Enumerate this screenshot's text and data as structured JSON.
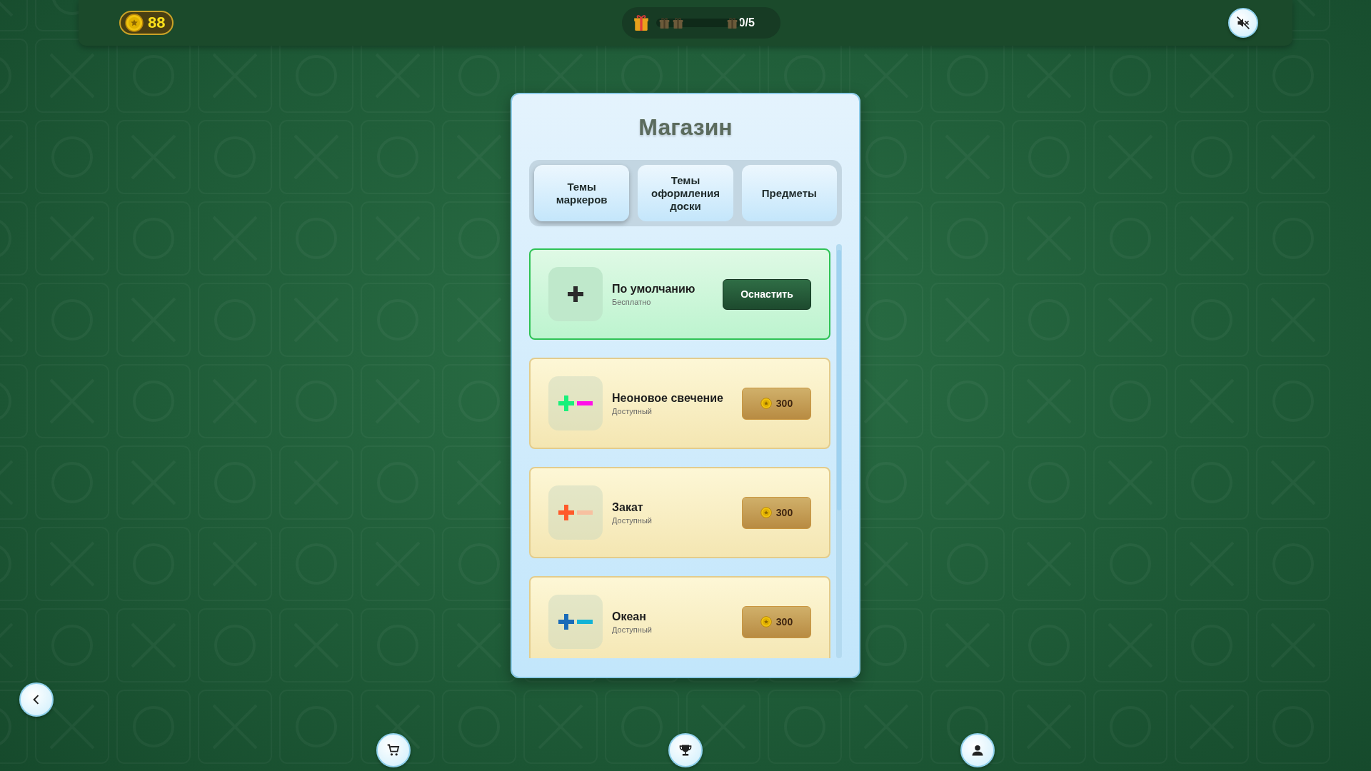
{
  "top_bar": {
    "coins": "88",
    "gift_progress": "0/5",
    "level": 0
  },
  "shop": {
    "title": "Магазин",
    "tabs": [
      {
        "label": "Темы маркеров",
        "selected": true
      },
      {
        "label": "Темы оформления доски",
        "selected": false
      },
      {
        "label": "Предметы",
        "selected": false
      }
    ],
    "items": [
      {
        "name": "По умолчанию",
        "status": "Бесплатно",
        "owned": true,
        "action": "Оснастить",
        "preview": [
          {
            "kind": "plus",
            "color": "#2b2b2b"
          }
        ]
      },
      {
        "name": "Неоновое свечение",
        "status": "Доступный",
        "owned": false,
        "price": "300",
        "preview": [
          {
            "kind": "plus",
            "color": "#19f07a"
          },
          {
            "kind": "minus",
            "color": "#ff10e8"
          }
        ]
      },
      {
        "name": "Закат",
        "status": "Доступный",
        "owned": false,
        "price": "300",
        "preview": [
          {
            "kind": "plus",
            "color": "#ff5a2a"
          },
          {
            "kind": "minus",
            "color": "#f7c0a0"
          }
        ]
      },
      {
        "name": "Океан",
        "status": "Доступный",
        "owned": false,
        "price": "300",
        "preview": [
          {
            "kind": "plus",
            "color": "#1a6bb8"
          },
          {
            "kind": "minus",
            "color": "#12b3d6"
          }
        ]
      }
    ]
  },
  "bottom_nav": [
    {
      "kind": "cart"
    },
    {
      "kind": "trophy"
    },
    {
      "kind": "profile"
    }
  ]
}
